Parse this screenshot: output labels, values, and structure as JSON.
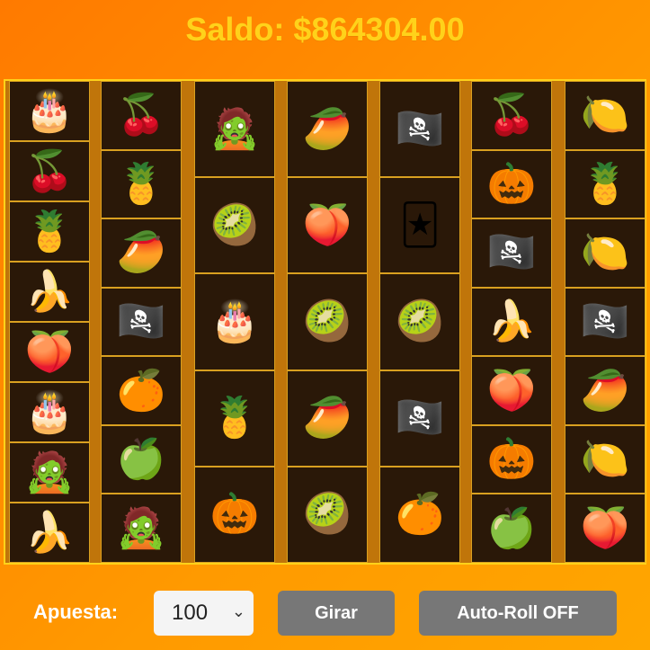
{
  "header": {
    "balance_text": "Saldo: $864304.00"
  },
  "colors": {
    "background": "#ff8a00",
    "accent": "#ffd21a",
    "reel_bg": "#2a1808",
    "button": "#777777"
  },
  "reels": [
    [
      "birthday-cake",
      "cherries",
      "pineapple",
      "banana",
      "peach",
      "birthday-cake",
      "zombie",
      "banana"
    ],
    [
      "cherries",
      "pineapple",
      "mango",
      "pirate-flag",
      "orange",
      "green-apple",
      "zombie"
    ],
    [
      "zombie",
      "kiwi",
      "birthday-cake",
      "pineapple",
      "jack-o-lantern"
    ],
    [
      "mango",
      "peach",
      "kiwi",
      "mango",
      "kiwi"
    ],
    [
      "pirate-flag",
      "joker-card",
      "kiwi",
      "pirate-flag",
      "orange"
    ],
    [
      "cherries",
      "jack-o-lantern",
      "pirate-flag",
      "banana",
      "peach",
      "jack-o-lantern",
      "green-apple"
    ],
    [
      "lemon",
      "pineapple",
      "lemon",
      "pirate-flag",
      "mango",
      "lemon",
      "peach"
    ]
  ],
  "controls": {
    "bet_label": "Apuesta:",
    "bet_value": "100",
    "spin_label": "Girar",
    "auto_label": "Auto-Roll OFF"
  }
}
